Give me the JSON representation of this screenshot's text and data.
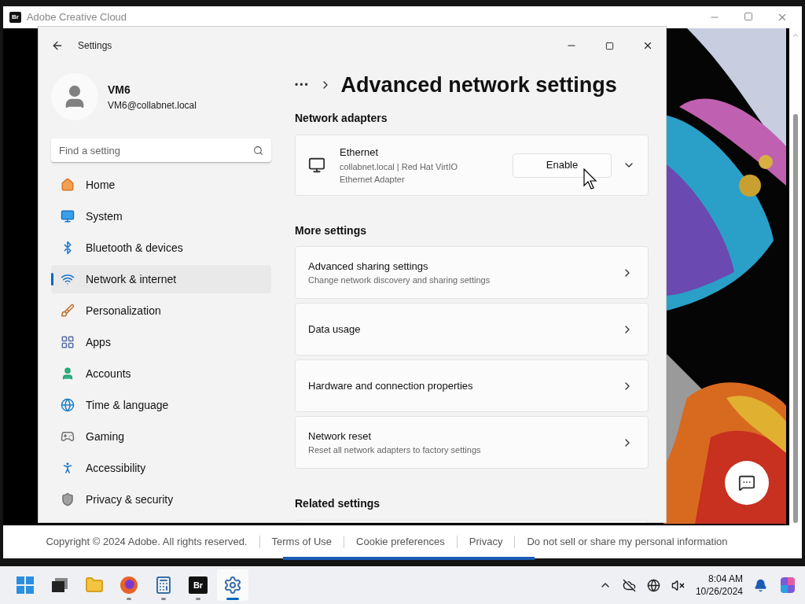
{
  "background_window": {
    "app_badge": "Br",
    "title": "Adobe Creative Cloud",
    "footer_links": [
      "Copyright © 2024 Adobe. All rights reserved.",
      "Terms of Use",
      "Cookie preferences",
      "Privacy",
      "Do not sell or share my personal information"
    ]
  },
  "settings_window": {
    "title": "Settings",
    "profile": {
      "name": "VM6",
      "email": "VM6@collabnet.local"
    },
    "search": {
      "placeholder": "Find a setting"
    },
    "nav_items": [
      {
        "label": "Home",
        "kind": "home",
        "selected": false
      },
      {
        "label": "System",
        "kind": "system",
        "selected": false
      },
      {
        "label": "Bluetooth & devices",
        "kind": "bluetooth",
        "selected": false
      },
      {
        "label": "Network & internet",
        "kind": "network",
        "selected": true
      },
      {
        "label": "Personalization",
        "kind": "brush",
        "selected": false
      },
      {
        "label": "Apps",
        "kind": "apps",
        "selected": false
      },
      {
        "label": "Accounts",
        "kind": "accounts",
        "selected": false
      },
      {
        "label": "Time & language",
        "kind": "time",
        "selected": false
      },
      {
        "label": "Gaming",
        "kind": "gaming",
        "selected": false
      },
      {
        "label": "Accessibility",
        "kind": "accessibility",
        "selected": false
      },
      {
        "label": "Privacy & security",
        "kind": "privacy",
        "selected": false
      }
    ],
    "breadcrumb": "•••",
    "page_title": "Advanced network settings",
    "network_adapters": {
      "heading": "Network adapters",
      "adapter": {
        "name": "Ethernet",
        "description": "collabnet.local | Red Hat VirtIO Ethernet Adapter",
        "button": "Enable"
      }
    },
    "more_settings": {
      "heading": "More settings",
      "items": [
        {
          "title": "Advanced sharing settings",
          "subtitle": "Change network discovery and sharing settings"
        },
        {
          "title": "Data usage"
        },
        {
          "title": "Hardware and connection properties"
        },
        {
          "title": "Network reset",
          "subtitle": "Reset all network adapters to factory settings"
        }
      ]
    },
    "related_settings": {
      "heading": "Related settings"
    }
  },
  "taskbar": {
    "apps": [
      {
        "kind": "start",
        "running": false,
        "active": false
      },
      {
        "kind": "task-view",
        "running": false,
        "active": false
      },
      {
        "kind": "folder",
        "running": false,
        "active": false
      },
      {
        "kind": "browser",
        "running": true,
        "active": false
      },
      {
        "kind": "calculator",
        "running": true,
        "active": false
      },
      {
        "kind": "bridge",
        "label": "Br",
        "running": true,
        "active": false
      },
      {
        "kind": "gear",
        "running": true,
        "active": true
      }
    ],
    "time": "8:04 AM",
    "date": "10/26/2024"
  }
}
